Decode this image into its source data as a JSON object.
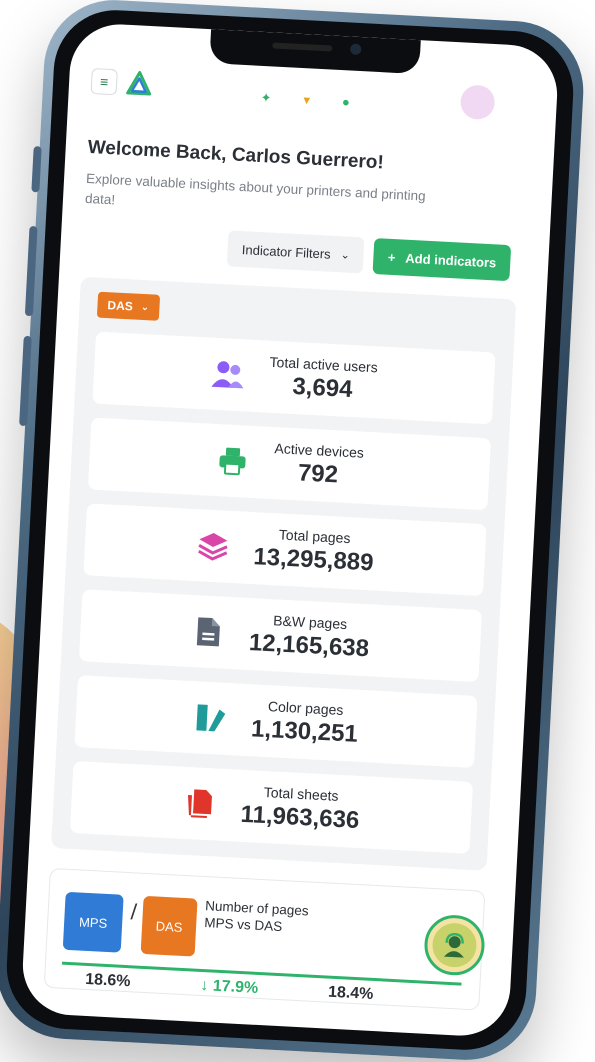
{
  "header": {
    "menu_icon": "hamburger-icon",
    "logo_icon": "triangle-logo-icon",
    "avatar_color": "#f1d8f3"
  },
  "welcome": {
    "title": "Welcome Back, Carlos Guerrero!",
    "subtitle": "Explore valuable insights about your printers and printing data!"
  },
  "filters": {
    "indicator_label": "Indicator Filters",
    "indicator_icon": "chevron-down-icon",
    "add_label": "Add indicators",
    "add_icon": "plus-icon"
  },
  "panel": {
    "selector_label": "DAS",
    "selector_color": "#e87722",
    "cards": [
      {
        "label": "Total active users",
        "value": "3,694",
        "icon": "users-icon",
        "color": "#8b5cf6"
      },
      {
        "label": "Active devices",
        "value": "792",
        "icon": "printer-icon",
        "color": "#2fb36b"
      },
      {
        "label": "Total pages",
        "value": "13,295,889",
        "icon": "layers-icon",
        "color": "#d946a8"
      },
      {
        "label": "B&W pages",
        "value": "12,165,638",
        "icon": "document-icon",
        "color": "#5b6472"
      },
      {
        "label": "Color pages",
        "value": "1,130,251",
        "icon": "color-pages-icon",
        "color": "#1f9c9a"
      },
      {
        "label": "Total sheets",
        "value": "11,963,636",
        "icon": "sheets-icon",
        "color": "#e0352b"
      }
    ]
  },
  "comparison": {
    "mps_label": "MPS",
    "separator": "/",
    "das_label": "DAS",
    "title": "Number of pages MPS vs DAS",
    "values": [
      "18.6%",
      "↓ 17.9%",
      "18.4%"
    ]
  },
  "support": {
    "icon": "headset-support-icon"
  },
  "colors": {
    "accent": "#2fb36b",
    "mps": "#2f7bd5",
    "das": "#e87722"
  }
}
